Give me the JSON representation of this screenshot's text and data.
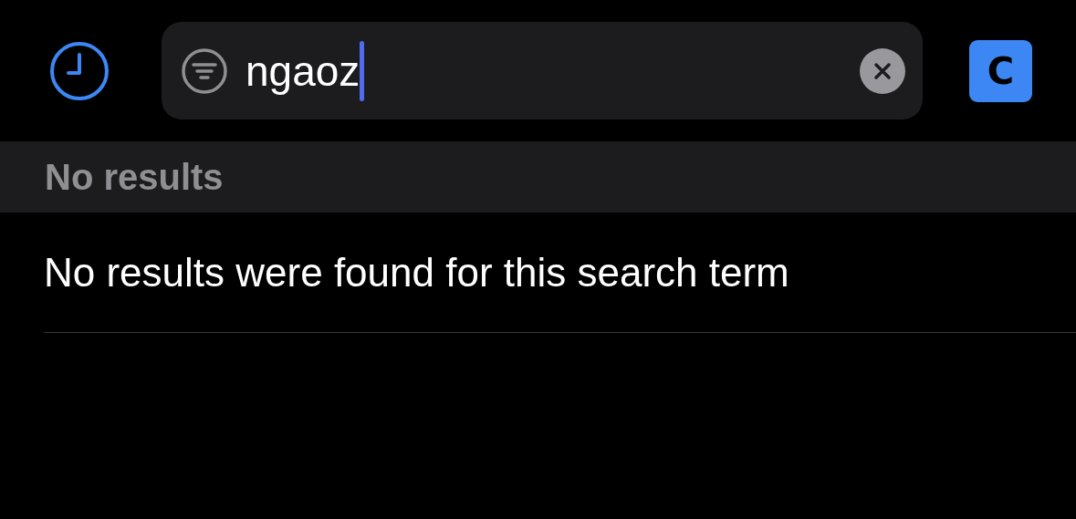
{
  "search": {
    "value": "ngaoz",
    "focused": true
  },
  "account": {
    "label": "C"
  },
  "section": {
    "header": "No results"
  },
  "message": "No results were found for this search term"
}
